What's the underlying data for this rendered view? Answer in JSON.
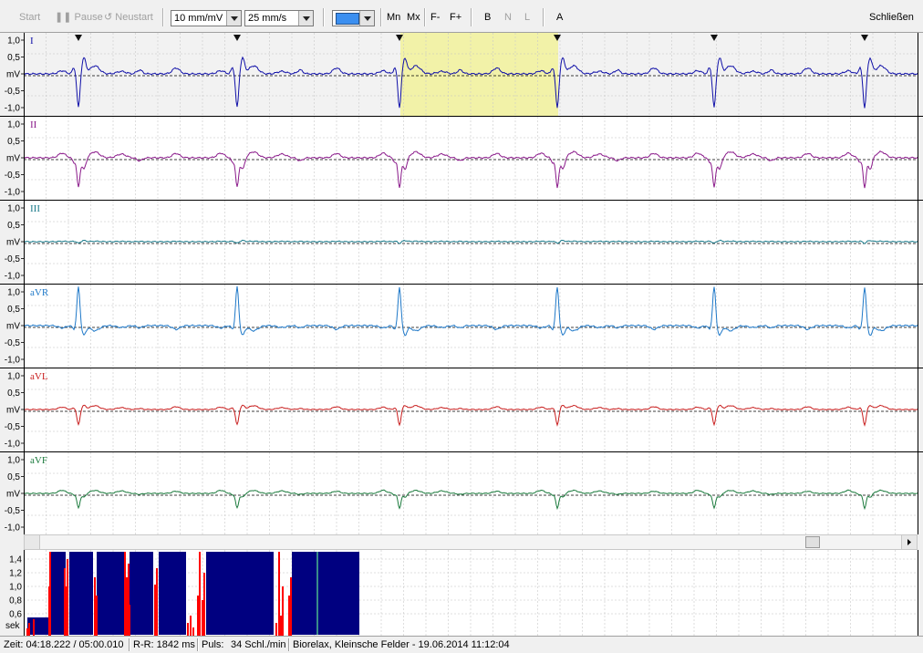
{
  "toolbar": {
    "start_label": "Start",
    "pause_label": "Pause",
    "pause_icon": "pause-icon",
    "restart_label": "Neustart",
    "restart_icon": "restart-icon",
    "amplitude_value": "10 mm/mV",
    "speed_value": "25 mm/s",
    "color_value": "#3b8ff0",
    "mn_label": "Mn",
    "mx_label": "Mx",
    "f_minus_label": "F-",
    "f_plus_label": "F+",
    "b_label": "B",
    "n_label": "N",
    "l_label": "L",
    "a_label": "A",
    "close_label": "Schließen"
  },
  "axis": {
    "ticks": [
      "1,0",
      "0,5",
      "mV",
      "-0,5",
      "-1,0"
    ]
  },
  "leads": [
    {
      "name": "I",
      "color": "#1010a8"
    },
    {
      "name": "II",
      "color": "#8a1a8a"
    },
    {
      "name": "III",
      "color": "#1a7a8a"
    },
    {
      "name": "aVR",
      "color": "#1e78c8"
    },
    {
      "name": "aVL",
      "color": "#c81e1e"
    },
    {
      "name": "aVF",
      "color": "#1a7a3c"
    }
  ],
  "rr_chart": {
    "ticks": [
      "1,4",
      "1,2",
      "1,0",
      "0,8",
      "0,6"
    ],
    "unit_label": "sek",
    "colors": {
      "bars": "#000080",
      "highlight": "#ff0000",
      "marker": "#3a8a8a"
    }
  },
  "status": {
    "time": "Zeit: 04:18.222 / 05:00.010",
    "rr": "R-R: 1842 ms",
    "pulse_label": "Puls:",
    "pulse_value": "34 Schl./min",
    "info": "Biorelax, Kleinsche Felder - 19.06.2014 11:12:04"
  }
}
